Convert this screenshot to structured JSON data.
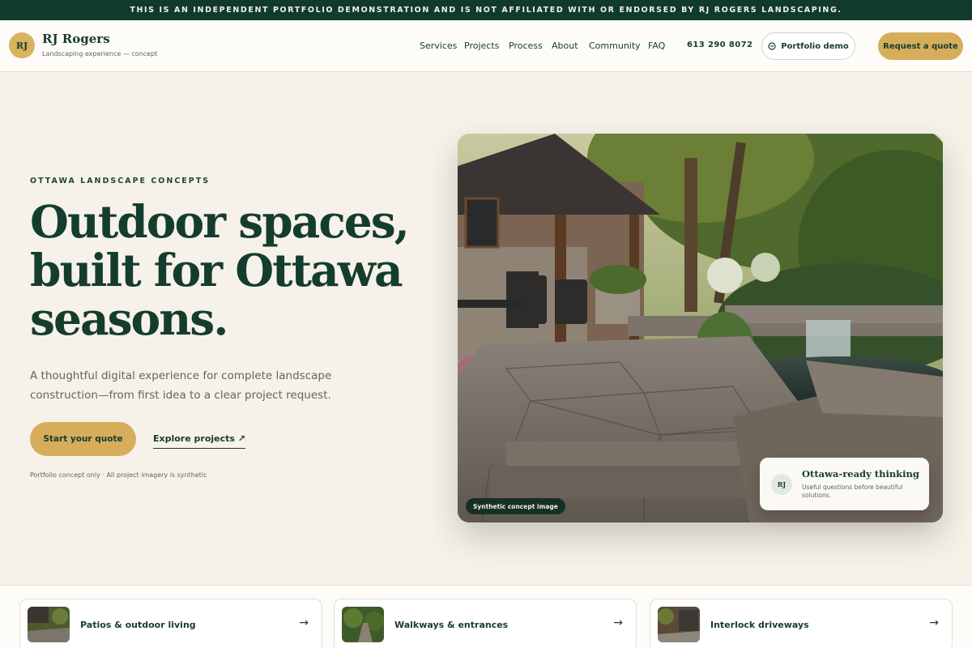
{
  "banner": {
    "text": "THIS IS AN INDEPENDENT PORTFOLIO DEMONSTRATION AND IS NOT AFFILIATED WITH OR ENDORSED BY RJ ROGERS LANDSCAPING."
  },
  "header": {
    "logo_initials": "RJ",
    "brand_name": "RJ Rogers",
    "brand_tagline": "Landscaping experience — concept",
    "nav": [
      "Services",
      "Projects",
      "Process",
      "About",
      "Community",
      "FAQ"
    ],
    "phone": "613 290 8072",
    "demo_button": "Portfolio demo",
    "quote_button": "Request a quote"
  },
  "hero": {
    "eyebrow": "OTTAWA LANDSCAPE CONCEPTS",
    "title_lines": [
      "Outdoor spaces,",
      "built for Ottawa",
      "seasons."
    ],
    "subtitle": "A thoughtful digital experience for complete landscape construction—from first idea to a clear project request.",
    "primary_cta": "Start your quote",
    "secondary_cta": "Explore projects ↗",
    "disclaimer": "Portfolio concept only · All project imagery is synthetic",
    "image_chip": "Synthetic concept image",
    "card": {
      "initials": "RJ",
      "title": "Ottawa-ready thinking",
      "text": "Useful questions before beautiful solutions."
    }
  },
  "services": [
    {
      "label": "Patios & outdoor living",
      "arrow": "→"
    },
    {
      "label": "Walkways & entrances",
      "arrow": "→"
    },
    {
      "label": "Interlock driveways",
      "arrow": "→"
    }
  ],
  "colors": {
    "brand_dark": "#103a2c",
    "accent_gold": "#d6ae5b",
    "background": "#f6f2ea"
  },
  "icons": {
    "demo_button_icon": "minus-circle-icon",
    "card_arrow": "arrow-right-icon"
  }
}
